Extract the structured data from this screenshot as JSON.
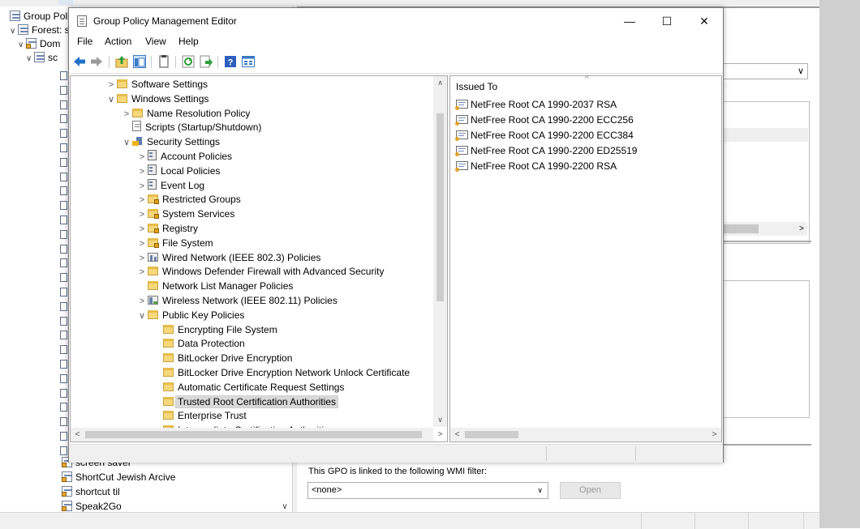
{
  "background": {
    "tree": [
      {
        "label": "Group Policy",
        "expander": "",
        "indent": 0,
        "icon": "gpo"
      },
      {
        "label": "Forest: sc",
        "expander": "∨",
        "indent": 1,
        "icon": "forest"
      },
      {
        "label": "Dom",
        "expander": "∨",
        "indent": 2,
        "icon": "domain"
      },
      {
        "label": "sc",
        "expander": "∨",
        "indent": 3,
        "icon": "gpo"
      }
    ],
    "bottom_items": [
      {
        "label": "screen saver"
      },
      {
        "label": "ShortCut Jewish Arcive"
      },
      {
        "label": "shortcut til"
      },
      {
        "label": "Speak2Go"
      }
    ],
    "wmi_label": "This GPO is linked to the following WMI filter:",
    "wmi_value": "<none>",
    "open_button": "Open"
  },
  "window": {
    "title": "Group Policy Management Editor",
    "minimize": "—",
    "maximize": "☐",
    "close": "✕"
  },
  "menu": [
    "File",
    "Action",
    "View",
    "Help"
  ],
  "toolbar_icons": [
    "back-icon",
    "forward-icon",
    "up-icon",
    "show-hide-tree-icon",
    "copy-icon",
    "refresh-icon",
    "export-icon",
    "help-icon",
    "properties-icon"
  ],
  "tree": [
    {
      "label": "Software Settings",
      "level": 0,
      "expander": ">",
      "icon": "folder"
    },
    {
      "label": "Windows Settings",
      "level": 0,
      "expander": "∨",
      "icon": "folder"
    },
    {
      "label": "Name Resolution Policy",
      "level": 1,
      "expander": ">",
      "icon": "folder"
    },
    {
      "label": "Scripts (Startup/Shutdown)",
      "level": 1,
      "expander": "",
      "icon": "doc"
    },
    {
      "label": "Security Settings",
      "level": 1,
      "expander": "∨",
      "icon": "sec"
    },
    {
      "label": "Account Policies",
      "level": 2,
      "expander": ">",
      "icon": "policy"
    },
    {
      "label": "Local Policies",
      "level": 2,
      "expander": ">",
      "icon": "policy"
    },
    {
      "label": "Event Log",
      "level": 2,
      "expander": ">",
      "icon": "policy"
    },
    {
      "label": "Restricted Groups",
      "level": 2,
      "expander": ">",
      "icon": "lock"
    },
    {
      "label": "System Services",
      "level": 2,
      "expander": ">",
      "icon": "lock"
    },
    {
      "label": "Registry",
      "level": 2,
      "expander": ">",
      "icon": "lock"
    },
    {
      "label": "File System",
      "level": 2,
      "expander": ">",
      "icon": "lock"
    },
    {
      "label": "Wired Network (IEEE 802.3) Policies",
      "level": 2,
      "expander": ">",
      "icon": "net"
    },
    {
      "label": "Windows Defender Firewall with Advanced Security",
      "level": 2,
      "expander": ">",
      "icon": "folder"
    },
    {
      "label": "Network List Manager Policies",
      "level": 2,
      "expander": "",
      "icon": "folder"
    },
    {
      "label": "Wireless Network (IEEE 802.11) Policies",
      "level": 2,
      "expander": ">",
      "icon": "wifi"
    },
    {
      "label": "Public Key Policies",
      "level": 2,
      "expander": "∨",
      "icon": "folder"
    },
    {
      "label": "Encrypting File System",
      "level": 3,
      "expander": "",
      "icon": "folder"
    },
    {
      "label": "Data Protection",
      "level": 3,
      "expander": "",
      "icon": "folder"
    },
    {
      "label": "BitLocker Drive Encryption",
      "level": 3,
      "expander": "",
      "icon": "folder"
    },
    {
      "label": "BitLocker Drive Encryption Network Unlock Certificate",
      "level": 3,
      "expander": "",
      "icon": "folder"
    },
    {
      "label": "Automatic Certificate Request Settings",
      "level": 3,
      "expander": "",
      "icon": "folder"
    },
    {
      "label": "Trusted Root Certification Authorities",
      "level": 3,
      "expander": "",
      "icon": "folder",
      "selected": true
    },
    {
      "label": "Enterprise Trust",
      "level": 3,
      "expander": "",
      "icon": "folder"
    },
    {
      "label": "Intermediate Certification Authorities",
      "level": 3,
      "expander": "",
      "icon": "folder"
    }
  ],
  "list": {
    "column": "Issued To",
    "sort_indicator": "^",
    "rows": [
      "NetFree Root CA 1990-2037 RSA",
      "NetFree Root CA 1990-2200 ECC256",
      "NetFree Root CA 1990-2200 ECC384",
      "NetFree Root CA 1990-2200 ED25519",
      "NetFree Root CA 1990-2200 RSA"
    ]
  },
  "scroll": {
    "left": "<",
    "right": ">",
    "up": "∧",
    "down": "∨"
  }
}
